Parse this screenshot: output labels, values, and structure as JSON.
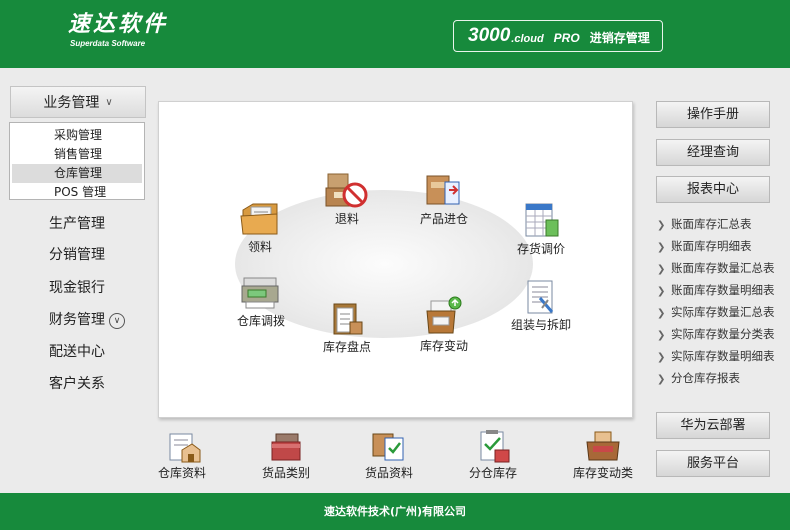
{
  "header": {
    "logo_cn": "速达软件",
    "logo_en": "Superdata Software",
    "product_num": "3000",
    "product_cloud": ".cloud",
    "product_pro": "PRO",
    "product_title": "进销存管理"
  },
  "sidebar": {
    "group_label": "业务管理",
    "submenu": [
      "采购管理",
      "销售管理",
      "仓库管理",
      "POS 管理"
    ],
    "active_submenu": "仓库管理",
    "items": [
      "生产管理",
      "分销管理",
      "现金银行",
      "财务管理",
      "配送中心",
      "客户关系"
    ]
  },
  "workflow": {
    "return": "退料",
    "product_in": "产品进仓",
    "requisition": "领料",
    "price_adjust": "存货调价",
    "transfer": "仓库调拨",
    "inventory_count": "库存盘点",
    "stock_change": "库存变动",
    "assembly": "组装与拆卸"
  },
  "bottom": [
    "仓库资料",
    "货品类别",
    "货品资料",
    "分仓库存",
    "库存变动类"
  ],
  "right": {
    "buttons_top": [
      "操作手册",
      "经理查询",
      "报表中心"
    ],
    "reports": [
      "账面库存汇总表",
      "账面库存明细表",
      "账面库存数量汇总表",
      "账面库存数量明细表",
      "实际库存数量汇总表",
      "实际库存数量分类表",
      "实际库存数量明细表",
      "分仓库存报表"
    ],
    "buttons_bottom": [
      "华为云部署",
      "服务平台"
    ]
  },
  "footer": {
    "company": "速达软件技术(广州)有限公司"
  },
  "colors": {
    "brand_green": "#178a3c",
    "active_bg": "#dcdcdc"
  }
}
